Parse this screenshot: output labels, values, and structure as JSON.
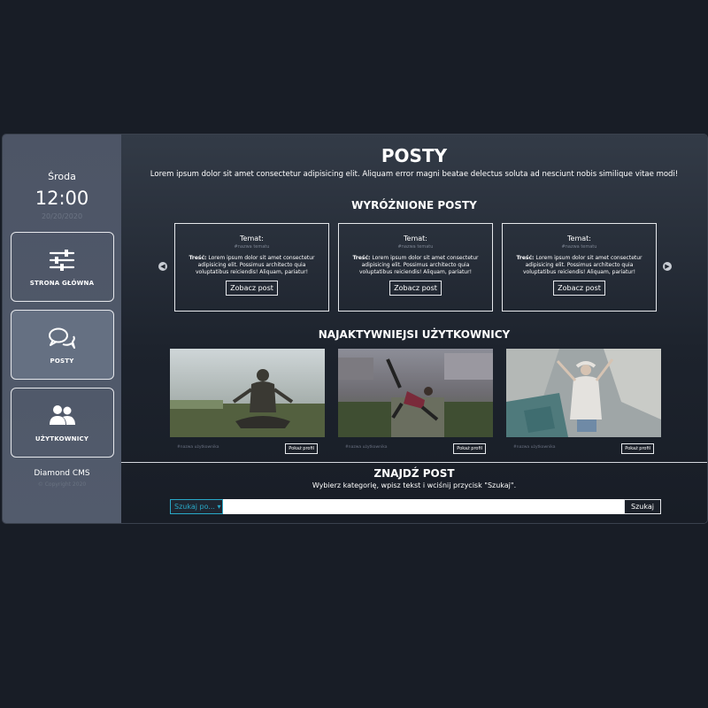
{
  "sidebar": {
    "day": "Środa",
    "time": "12:00",
    "date": "20/20/2020",
    "nav": [
      {
        "label": "STRONA GŁÓWNA",
        "icon": "sliders-icon"
      },
      {
        "label": "POSTY",
        "icon": "chat-icon"
      },
      {
        "label": "UŻYTKOWNICY",
        "icon": "users-icon"
      }
    ],
    "active_index": 1,
    "brand": "Diamond CMS",
    "copyright": "© Copyright 2020"
  },
  "main": {
    "title": "POSTY",
    "subtitle": "Lorem ipsum dolor sit amet consectetur adipisicing elit. Aliquam error magni beatae delectus soluta ad nesciunt nobis similique vitae modi!",
    "featured": {
      "title": "WYRÓŻNIONE POSTY",
      "posts": [
        {
          "topic_label": "Temat:",
          "topic_name": "#nazwa tematu",
          "content_label": "Treść:",
          "content": "Lorem ipsum dolor sit amet consectetur adipisicing elit. Possimus architecto quia voluptatibus reiciendis! Aliquam, pariatur!",
          "button": "Zobacz post"
        },
        {
          "topic_label": "Temat:",
          "topic_name": "#nazwa tematu",
          "content_label": "Treść:",
          "content": "Lorem ipsum dolor sit amet consectetur adipisicing elit. Possimus architecto quia voluptatibus reiciendis! Aliquam, pariatur!",
          "button": "Zobacz post"
        },
        {
          "topic_label": "Temat:",
          "topic_name": "#nazwa tematu",
          "content_label": "Treść:",
          "content": "Lorem ipsum dolor sit amet consectetur adipisicing elit. Possimus architecto quia voluptatibus reiciendis! Aliquam, pariatur!",
          "button": "Zobacz post"
        }
      ],
      "prev_icon": "chevron-left-icon",
      "next_icon": "chevron-right-icon"
    },
    "users": {
      "title": "NAJAKTYWNIEJSI UŻYTKOWNICY",
      "items": [
        {
          "name": "#nazwa użytkownika",
          "button": "Pokaż profil"
        },
        {
          "name": "#nazwa użytkownika",
          "button": "Pokaż profil"
        },
        {
          "name": "#nazwa użytkownika",
          "button": "Pokaż profil"
        }
      ]
    },
    "search": {
      "title": "ZNAJDŹ POST",
      "subtitle": "Wybierz kategorię, wpisz tekst i wciśnij przycisk \"Szukaj\".",
      "select_label": "Szukaj po... ▾",
      "input_value": "",
      "button": "Szukaj"
    }
  },
  "colors": {
    "background": "#181d26",
    "sidebar": "#4f5769",
    "accent": "#29a9c8"
  }
}
